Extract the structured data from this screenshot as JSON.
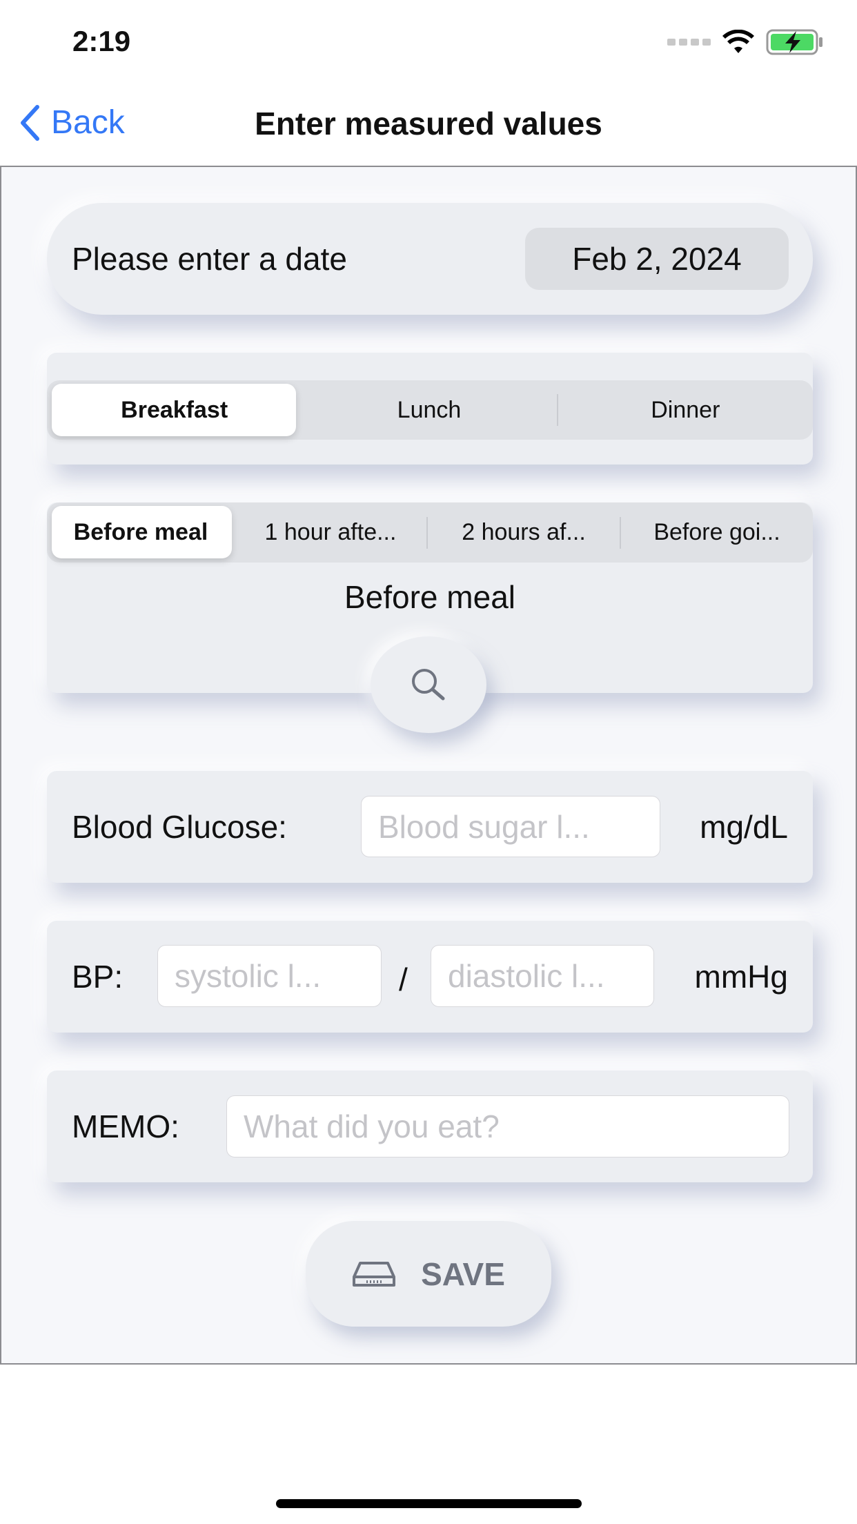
{
  "status": {
    "time": "2:19"
  },
  "nav": {
    "back": "Back",
    "title": "Enter measured values"
  },
  "date": {
    "label": "Please enter a date",
    "value": "Feb 2, 2024"
  },
  "meal_segment": {
    "items": [
      "Breakfast",
      "Lunch",
      "Dinner"
    ],
    "selected": "Breakfast"
  },
  "timing_segment": {
    "items": [
      "Before meal",
      "1 hour afte...",
      "2 hours af...",
      "Before goi..."
    ],
    "selected": "Before meal",
    "current": "Before meal"
  },
  "glucose": {
    "label": "Blood Glucose:",
    "placeholder": "Blood sugar l...",
    "unit": "mg/dL"
  },
  "bp": {
    "label": "BP:",
    "systolic_placeholder": "systolic l...",
    "separator": "/",
    "diastolic_placeholder": "diastolic l...",
    "unit": "mmHg"
  },
  "memo": {
    "label": "MEMO:",
    "placeholder": "What did you eat?"
  },
  "save": {
    "label": "SAVE",
    "icon": "save-drive-icon"
  },
  "colors": {
    "accent": "#3478f6",
    "card": "#eceef2",
    "battery": "#4cd964"
  }
}
